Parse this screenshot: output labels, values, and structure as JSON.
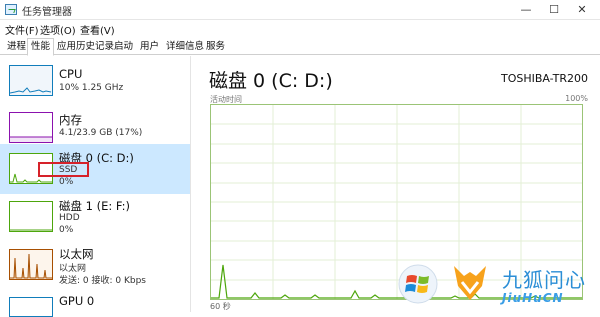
{
  "window": {
    "title": "任务管理器",
    "controls": [
      "—",
      "☐",
      "✕"
    ]
  },
  "menu": [
    "文件(F)",
    "选项(O)",
    "查看(V)"
  ],
  "tabs": [
    "进程",
    "性能",
    "应用历史记录",
    "启动",
    "用户",
    "详细信息",
    "服务"
  ],
  "active_tab": "性能",
  "sidebar": {
    "items": [
      {
        "name": "CPU",
        "line1": "10% 1.25 GHz",
        "line2": "",
        "color": "#117dbb",
        "level": 0.1
      },
      {
        "name": "内存",
        "line1": "4.1/23.9 GB (17%)",
        "line2": "",
        "color": "#8b12ae",
        "level": 0.17
      },
      {
        "name": "磁盘 0 (C: D:)",
        "line1": "SSD",
        "line2": "0%",
        "color": "#4da60c",
        "level": 0.0,
        "selected": true
      },
      {
        "name": "磁盘 1 (E: F:)",
        "line1": "HDD",
        "line2": "0%",
        "color": "#4da60c",
        "level": 0.0
      },
      {
        "name": "以太网",
        "line1": "以太网",
        "line2": "发送: 0 接收: 0 Kbps",
        "color": "#a74f01",
        "level": 0.0
      },
      {
        "name": "GPU 0",
        "line1": "",
        "line2": "",
        "color": "#117dbb",
        "level": 0.0
      }
    ]
  },
  "main": {
    "title": "磁盘 0 (C: D:)",
    "model": "TOSHIBA-TR200",
    "graph_label": "活动时间",
    "graph_max": "100%",
    "graph_time": "60 秒",
    "graph_color": "#4da60c"
  },
  "watermark": {
    "text": "九狐问心",
    "subtext": "JiuHuCN"
  }
}
